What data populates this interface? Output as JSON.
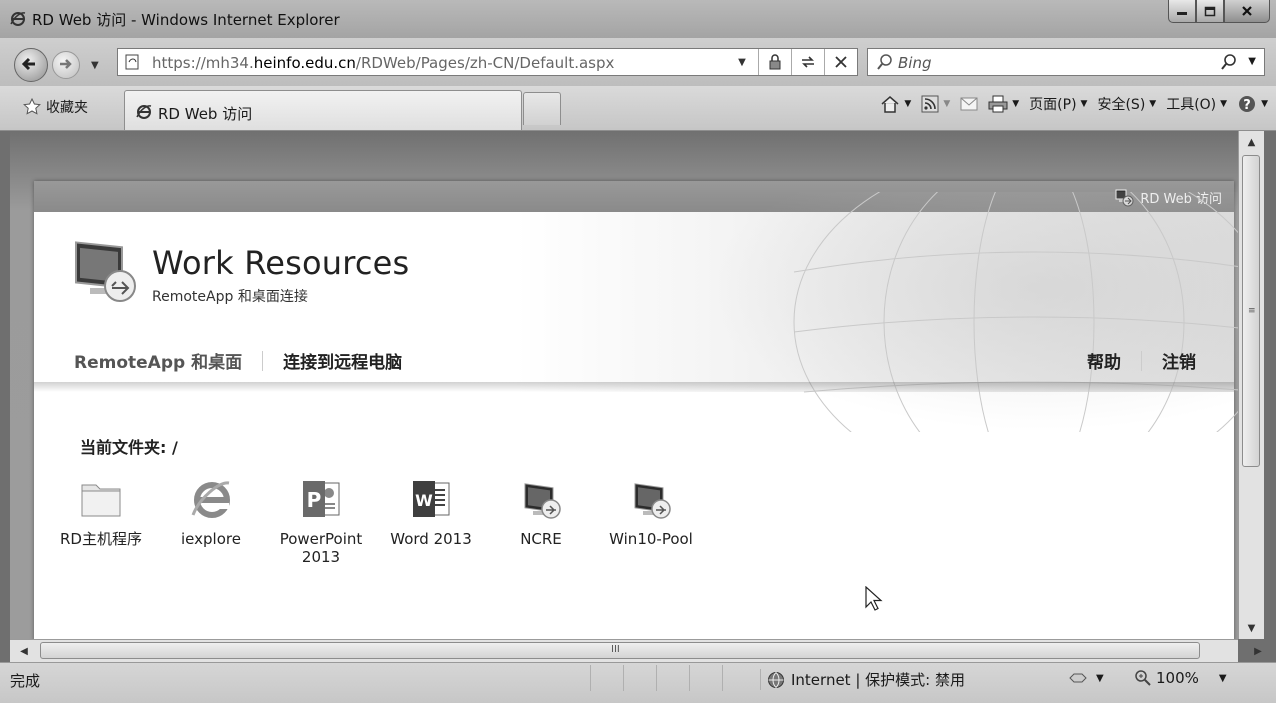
{
  "window": {
    "title": "RD Web 访问 - Windows Internet Explorer"
  },
  "address": {
    "url_prefix": "https://mh34.",
    "url_host": "heinfo.edu.cn",
    "url_path": "/RDWeb/Pages/zh-CN/Default.aspx",
    "search_placeholder": "Bing"
  },
  "favorites": {
    "label": "收藏夹"
  },
  "tab": {
    "label": "RD Web 访问"
  },
  "commands": {
    "page": "页面(P)",
    "safety": "安全(S)",
    "tools": "工具(O)"
  },
  "site": {
    "top_link": "RD Web 访问",
    "title": "Work Resources",
    "subtitle": "RemoteApp 和桌面连接",
    "nav": {
      "remoteapp": "RemoteApp 和桌面",
      "connect": "连接到远程电脑",
      "help": "帮助",
      "logout": "注销"
    },
    "current_folder": "当前文件夹: /",
    "apps": [
      {
        "name": "RD主机程序",
        "icon": "folder-icon"
      },
      {
        "name": "iexplore",
        "icon": "internet-explorer-icon"
      },
      {
        "name": "PowerPoint 2013",
        "icon": "powerpoint-icon"
      },
      {
        "name": "Word 2013",
        "icon": "word-icon"
      },
      {
        "name": "NCRE",
        "icon": "remote-desktop-icon"
      },
      {
        "name": "Win10-Pool",
        "icon": "remote-desktop-icon"
      }
    ]
  },
  "status": {
    "text": "完成",
    "zone": "Internet | 保护模式: 禁用",
    "zoom": "100%"
  }
}
